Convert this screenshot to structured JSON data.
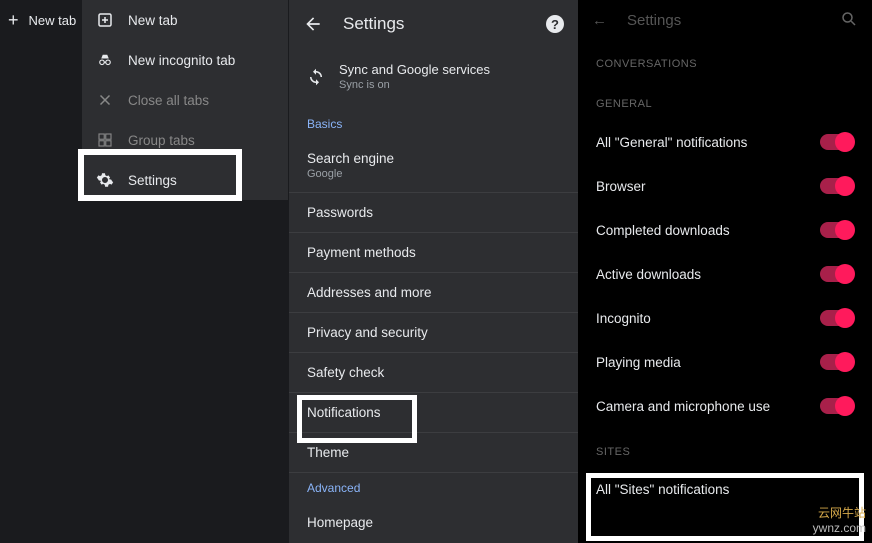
{
  "panel1": {
    "new_tab_top": "New tab",
    "menu": [
      {
        "icon": "new-tab",
        "label": "New tab",
        "dim": false
      },
      {
        "icon": "incognito",
        "label": "New incognito tab",
        "dim": false
      },
      {
        "icon": "close",
        "label": "Close all tabs",
        "dim": true
      },
      {
        "icon": "group",
        "label": "Group tabs",
        "dim": true
      },
      {
        "icon": "settings",
        "label": "Settings",
        "dim": false
      }
    ]
  },
  "panel2": {
    "title": "Settings",
    "sync": {
      "title": "Sync and Google services",
      "sub": "Sync is on"
    },
    "section_basics": "Basics",
    "rows_basics": [
      {
        "label": "Search engine",
        "sub": "Google"
      },
      {
        "label": "Passwords"
      },
      {
        "label": "Payment methods"
      },
      {
        "label": "Addresses and more"
      },
      {
        "label": "Privacy and security"
      },
      {
        "label": "Safety check"
      },
      {
        "label": "Notifications"
      },
      {
        "label": "Theme"
      }
    ],
    "section_advanced": "Advanced",
    "rows_advanced": [
      {
        "label": "Homepage"
      }
    ]
  },
  "panel3": {
    "header": "Settings",
    "section_conversations": "CONVERSATIONS",
    "section_general": "GENERAL",
    "rows_general": [
      "All \"General\" notifications",
      "Browser",
      "Completed downloads",
      "Active downloads",
      "Incognito",
      "Playing media",
      "Camera and microphone use"
    ],
    "section_sites": "SITES",
    "rows_sites": [
      "All \"Sites\" notifications"
    ]
  },
  "watermark": {
    "l1": "云网牛站",
    "l2": "ywnz.com"
  }
}
